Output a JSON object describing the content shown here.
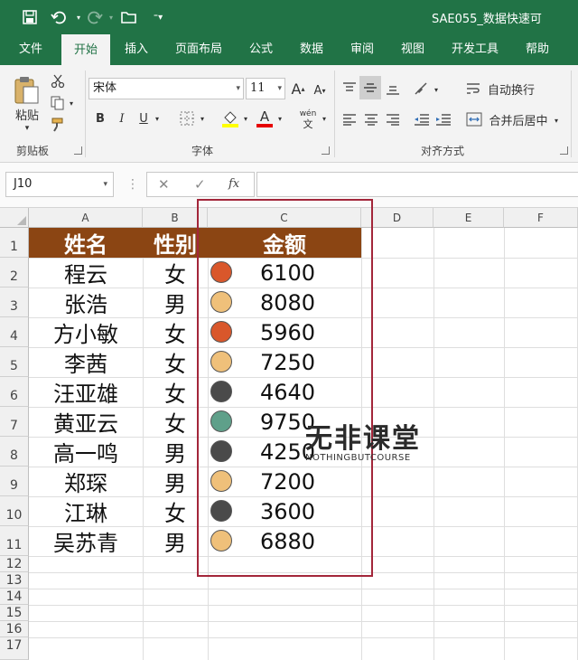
{
  "titlebar": {
    "doc_title": "SAE055_数据快速可",
    "save_icon": "save-icon",
    "undo_icon": "undo-icon",
    "redo_icon": "redo-icon",
    "open_icon": "open-folder-icon",
    "customize_icon": "customize-quick-access-icon"
  },
  "menu": {
    "tabs": [
      "文件",
      "开始",
      "插入",
      "页面布局",
      "公式",
      "数据",
      "审阅",
      "视图",
      "开发工具",
      "帮助"
    ],
    "active": "开始"
  },
  "ribbon": {
    "clipboard": {
      "paste_label": "粘贴",
      "group_label": "剪贴板"
    },
    "font": {
      "font_name": "宋体",
      "font_size": "11",
      "grow_label": "A",
      "shrink_label": "A",
      "bold_label": "B",
      "italic_label": "I",
      "underline_label": "U",
      "font_color_label": "A",
      "phonetic_label": "wén",
      "phonetic_sub": "文",
      "group_label": "字体"
    },
    "alignment": {
      "wrap_text": "自动换行",
      "merge_center": "合并后居中",
      "group_label": "对齐方式"
    }
  },
  "formula_bar": {
    "name_box": "J10",
    "cancel_icon": "cancel-icon",
    "enter_icon": "enter-icon",
    "fx_label": "fx",
    "formula": ""
  },
  "sheet": {
    "columns": [
      "A",
      "B",
      "C",
      "D",
      "E",
      "F"
    ],
    "rows": [
      "1",
      "2",
      "3",
      "4",
      "5",
      "6",
      "7",
      "8",
      "9",
      "10",
      "11",
      "12",
      "13",
      "14",
      "15",
      "16",
      "17"
    ],
    "headers": {
      "name": "姓名",
      "gender": "性别",
      "amount": "金额"
    },
    "header_fill": "#8b4513",
    "records": [
      {
        "name": "程云",
        "gender": "女",
        "amount": "6100",
        "dot": "#d9572b"
      },
      {
        "name": "张浩",
        "gender": "男",
        "amount": "8080",
        "dot": "#efc07a"
      },
      {
        "name": "方小敏",
        "gender": "女",
        "amount": "5960",
        "dot": "#d9572b"
      },
      {
        "name": "李茜",
        "gender": "女",
        "amount": "7250",
        "dot": "#efc07a"
      },
      {
        "name": "汪亚雄",
        "gender": "女",
        "amount": "4640",
        "dot": "#4a4a4a"
      },
      {
        "name": "黄亚云",
        "gender": "女",
        "amount": "9750",
        "dot": "#5fa08a"
      },
      {
        "name": "高一鸣",
        "gender": "男",
        "amount": "4250",
        "dot": "#4a4a4a"
      },
      {
        "name": "郑琛",
        "gender": "男",
        "amount": "7200",
        "dot": "#efc07a"
      },
      {
        "name": "江琳",
        "gender": "女",
        "amount": "3600",
        "dot": "#4a4a4a"
      },
      {
        "name": "吴苏青",
        "gender": "男",
        "amount": "6880",
        "dot": "#efc07a"
      }
    ]
  },
  "watermark": {
    "big": "无非课堂",
    "small": "NOTHINGBUTCOURSE"
  },
  "colors": {
    "excel_green": "#217346",
    "highlight": "#a3263a"
  }
}
